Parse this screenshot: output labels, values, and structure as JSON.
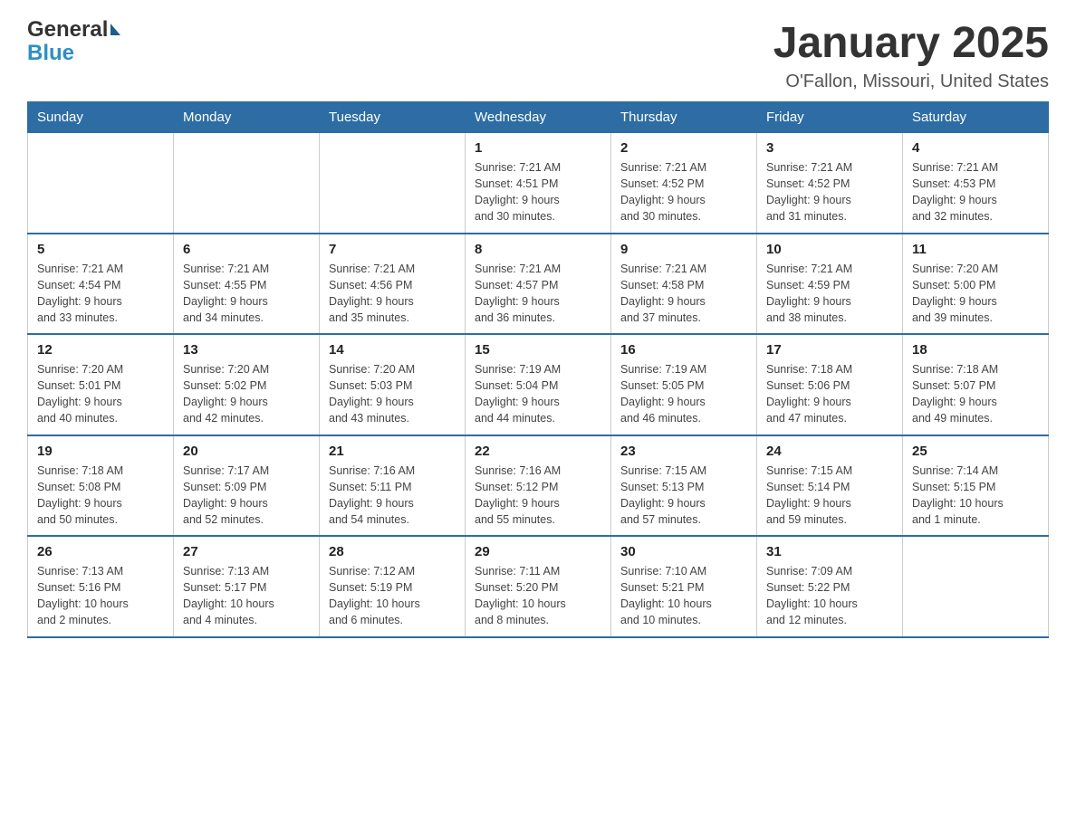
{
  "logo": {
    "text_general": "General",
    "text_blue": "Blue"
  },
  "header": {
    "month": "January 2025",
    "location": "O'Fallon, Missouri, United States"
  },
  "days_of_week": [
    "Sunday",
    "Monday",
    "Tuesday",
    "Wednesday",
    "Thursday",
    "Friday",
    "Saturday"
  ],
  "weeks": [
    [
      {
        "day": "",
        "info": ""
      },
      {
        "day": "",
        "info": ""
      },
      {
        "day": "",
        "info": ""
      },
      {
        "day": "1",
        "info": "Sunrise: 7:21 AM\nSunset: 4:51 PM\nDaylight: 9 hours\nand 30 minutes."
      },
      {
        "day": "2",
        "info": "Sunrise: 7:21 AM\nSunset: 4:52 PM\nDaylight: 9 hours\nand 30 minutes."
      },
      {
        "day": "3",
        "info": "Sunrise: 7:21 AM\nSunset: 4:52 PM\nDaylight: 9 hours\nand 31 minutes."
      },
      {
        "day": "4",
        "info": "Sunrise: 7:21 AM\nSunset: 4:53 PM\nDaylight: 9 hours\nand 32 minutes."
      }
    ],
    [
      {
        "day": "5",
        "info": "Sunrise: 7:21 AM\nSunset: 4:54 PM\nDaylight: 9 hours\nand 33 minutes."
      },
      {
        "day": "6",
        "info": "Sunrise: 7:21 AM\nSunset: 4:55 PM\nDaylight: 9 hours\nand 34 minutes."
      },
      {
        "day": "7",
        "info": "Sunrise: 7:21 AM\nSunset: 4:56 PM\nDaylight: 9 hours\nand 35 minutes."
      },
      {
        "day": "8",
        "info": "Sunrise: 7:21 AM\nSunset: 4:57 PM\nDaylight: 9 hours\nand 36 minutes."
      },
      {
        "day": "9",
        "info": "Sunrise: 7:21 AM\nSunset: 4:58 PM\nDaylight: 9 hours\nand 37 minutes."
      },
      {
        "day": "10",
        "info": "Sunrise: 7:21 AM\nSunset: 4:59 PM\nDaylight: 9 hours\nand 38 minutes."
      },
      {
        "day": "11",
        "info": "Sunrise: 7:20 AM\nSunset: 5:00 PM\nDaylight: 9 hours\nand 39 minutes."
      }
    ],
    [
      {
        "day": "12",
        "info": "Sunrise: 7:20 AM\nSunset: 5:01 PM\nDaylight: 9 hours\nand 40 minutes."
      },
      {
        "day": "13",
        "info": "Sunrise: 7:20 AM\nSunset: 5:02 PM\nDaylight: 9 hours\nand 42 minutes."
      },
      {
        "day": "14",
        "info": "Sunrise: 7:20 AM\nSunset: 5:03 PM\nDaylight: 9 hours\nand 43 minutes."
      },
      {
        "day": "15",
        "info": "Sunrise: 7:19 AM\nSunset: 5:04 PM\nDaylight: 9 hours\nand 44 minutes."
      },
      {
        "day": "16",
        "info": "Sunrise: 7:19 AM\nSunset: 5:05 PM\nDaylight: 9 hours\nand 46 minutes."
      },
      {
        "day": "17",
        "info": "Sunrise: 7:18 AM\nSunset: 5:06 PM\nDaylight: 9 hours\nand 47 minutes."
      },
      {
        "day": "18",
        "info": "Sunrise: 7:18 AM\nSunset: 5:07 PM\nDaylight: 9 hours\nand 49 minutes."
      }
    ],
    [
      {
        "day": "19",
        "info": "Sunrise: 7:18 AM\nSunset: 5:08 PM\nDaylight: 9 hours\nand 50 minutes."
      },
      {
        "day": "20",
        "info": "Sunrise: 7:17 AM\nSunset: 5:09 PM\nDaylight: 9 hours\nand 52 minutes."
      },
      {
        "day": "21",
        "info": "Sunrise: 7:16 AM\nSunset: 5:11 PM\nDaylight: 9 hours\nand 54 minutes."
      },
      {
        "day": "22",
        "info": "Sunrise: 7:16 AM\nSunset: 5:12 PM\nDaylight: 9 hours\nand 55 minutes."
      },
      {
        "day": "23",
        "info": "Sunrise: 7:15 AM\nSunset: 5:13 PM\nDaylight: 9 hours\nand 57 minutes."
      },
      {
        "day": "24",
        "info": "Sunrise: 7:15 AM\nSunset: 5:14 PM\nDaylight: 9 hours\nand 59 minutes."
      },
      {
        "day": "25",
        "info": "Sunrise: 7:14 AM\nSunset: 5:15 PM\nDaylight: 10 hours\nand 1 minute."
      }
    ],
    [
      {
        "day": "26",
        "info": "Sunrise: 7:13 AM\nSunset: 5:16 PM\nDaylight: 10 hours\nand 2 minutes."
      },
      {
        "day": "27",
        "info": "Sunrise: 7:13 AM\nSunset: 5:17 PM\nDaylight: 10 hours\nand 4 minutes."
      },
      {
        "day": "28",
        "info": "Sunrise: 7:12 AM\nSunset: 5:19 PM\nDaylight: 10 hours\nand 6 minutes."
      },
      {
        "day": "29",
        "info": "Sunrise: 7:11 AM\nSunset: 5:20 PM\nDaylight: 10 hours\nand 8 minutes."
      },
      {
        "day": "30",
        "info": "Sunrise: 7:10 AM\nSunset: 5:21 PM\nDaylight: 10 hours\nand 10 minutes."
      },
      {
        "day": "31",
        "info": "Sunrise: 7:09 AM\nSunset: 5:22 PM\nDaylight: 10 hours\nand 12 minutes."
      },
      {
        "day": "",
        "info": ""
      }
    ]
  ]
}
